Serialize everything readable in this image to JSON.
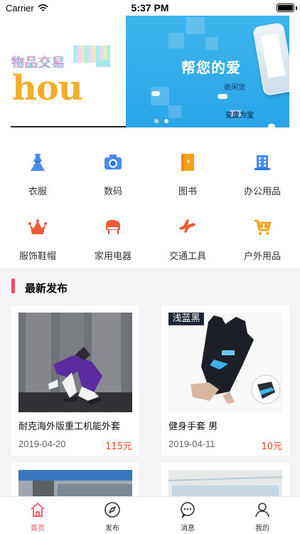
{
  "status": {
    "carrier": "Carrier",
    "time": "5:37 PM"
  },
  "banner": {
    "logo_text_cn": "物品交易",
    "logo_text_en": "hou",
    "promo_title": "帮您的爱",
    "promo_sub": "收闲货",
    "promo_bottom": "变废为宝"
  },
  "categories": [
    {
      "label": "衣服",
      "icon": "dress-icon"
    },
    {
      "label": "数码",
      "icon": "camera-icon"
    },
    {
      "label": "图书",
      "icon": "book-icon"
    },
    {
      "label": "办公用品",
      "icon": "office-building-icon"
    },
    {
      "label": "服饰鞋帽",
      "icon": "crown-icon"
    },
    {
      "label": "家用电器",
      "icon": "piano-icon"
    },
    {
      "label": "交通工具",
      "icon": "airplane-icon"
    },
    {
      "label": "户外用品",
      "icon": "cart-icon"
    }
  ],
  "latest": {
    "title": "最新发布",
    "products": [
      {
        "title": "耐克海外版重工机能外套",
        "date": "2019-04-20",
        "price": "115元"
      },
      {
        "title": "健身手套 男",
        "date": "2019-04-11",
        "price": "10元",
        "badge": "浅蓝黑"
      }
    ]
  },
  "tabs": [
    {
      "label": "首页",
      "icon": "home-icon"
    },
    {
      "label": "发布",
      "icon": "compass-icon"
    },
    {
      "label": "消息",
      "icon": "message-icon"
    },
    {
      "label": "我的",
      "icon": "profile-icon"
    }
  ],
  "colors": {
    "accent": "#f04f5d",
    "price": "#e94a2a",
    "promo_blue": "#2aa6e8"
  }
}
